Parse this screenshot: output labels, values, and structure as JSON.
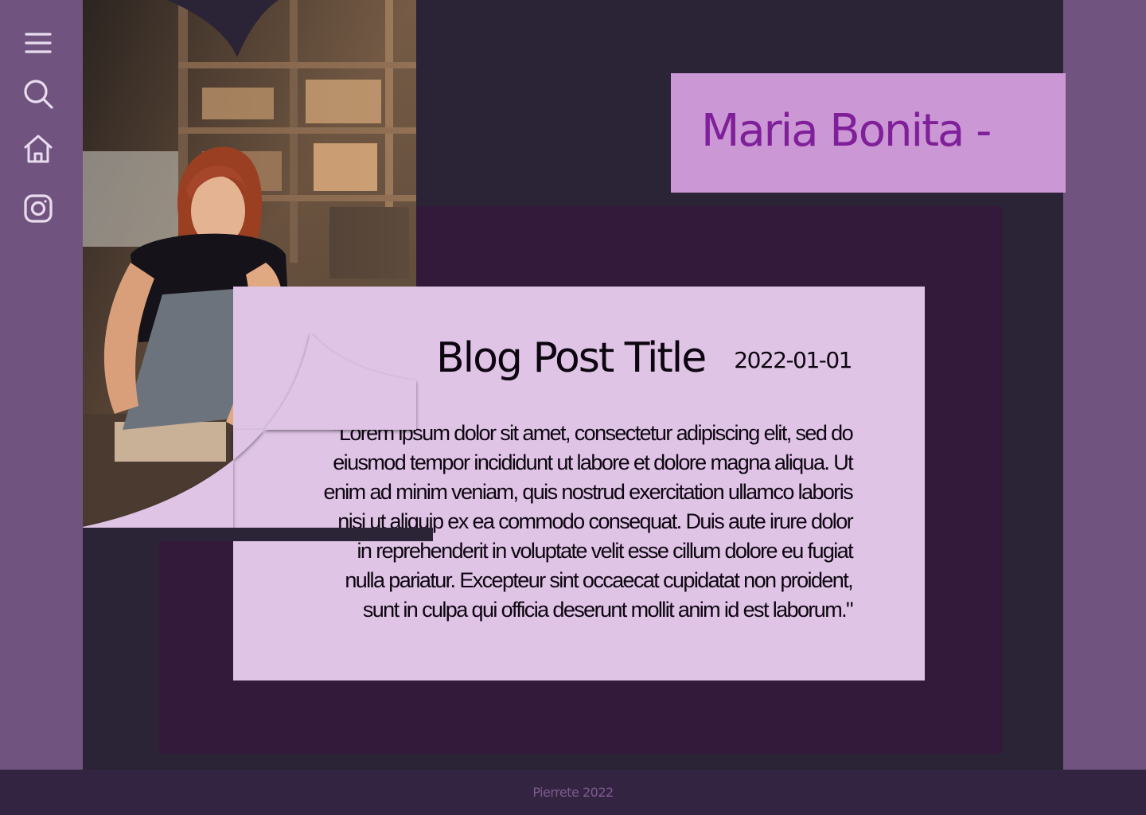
{
  "sidebar": {
    "icons": [
      "menu-icon",
      "search-icon",
      "home-icon",
      "instagram-icon"
    ]
  },
  "header": {
    "name": "Maria Bonita -"
  },
  "post": {
    "title": "Blog Post Title",
    "date": "2022-01-01",
    "body": "\"Lorem ipsum dolor sit amet, consectetur adipiscing elit, sed do eiusmod tempor incididunt ut labore et dolore magna aliqua. Ut enim ad minim veniam, quis nostrud exercitation ullamco laboris nisi ut aliquip ex ea commodo consequat. Duis aute irure dolor in reprehenderit in voluptate velit esse cillum dolore eu fugiat nulla pariatur. Excepteur sint occaecat cupidatat non proident, sunt in culpa qui officia deserunt mollit anim id est laborum.\""
  },
  "footer": {
    "text": "Pierrete 2022"
  },
  "colors": {
    "sidebar": "#70547f",
    "background": "#2b2336",
    "panel": "#331a3b",
    "name_banner": "#cb97d5",
    "name_text": "#7f1f99",
    "card": "#dfc4e6",
    "footer": "#332541"
  }
}
